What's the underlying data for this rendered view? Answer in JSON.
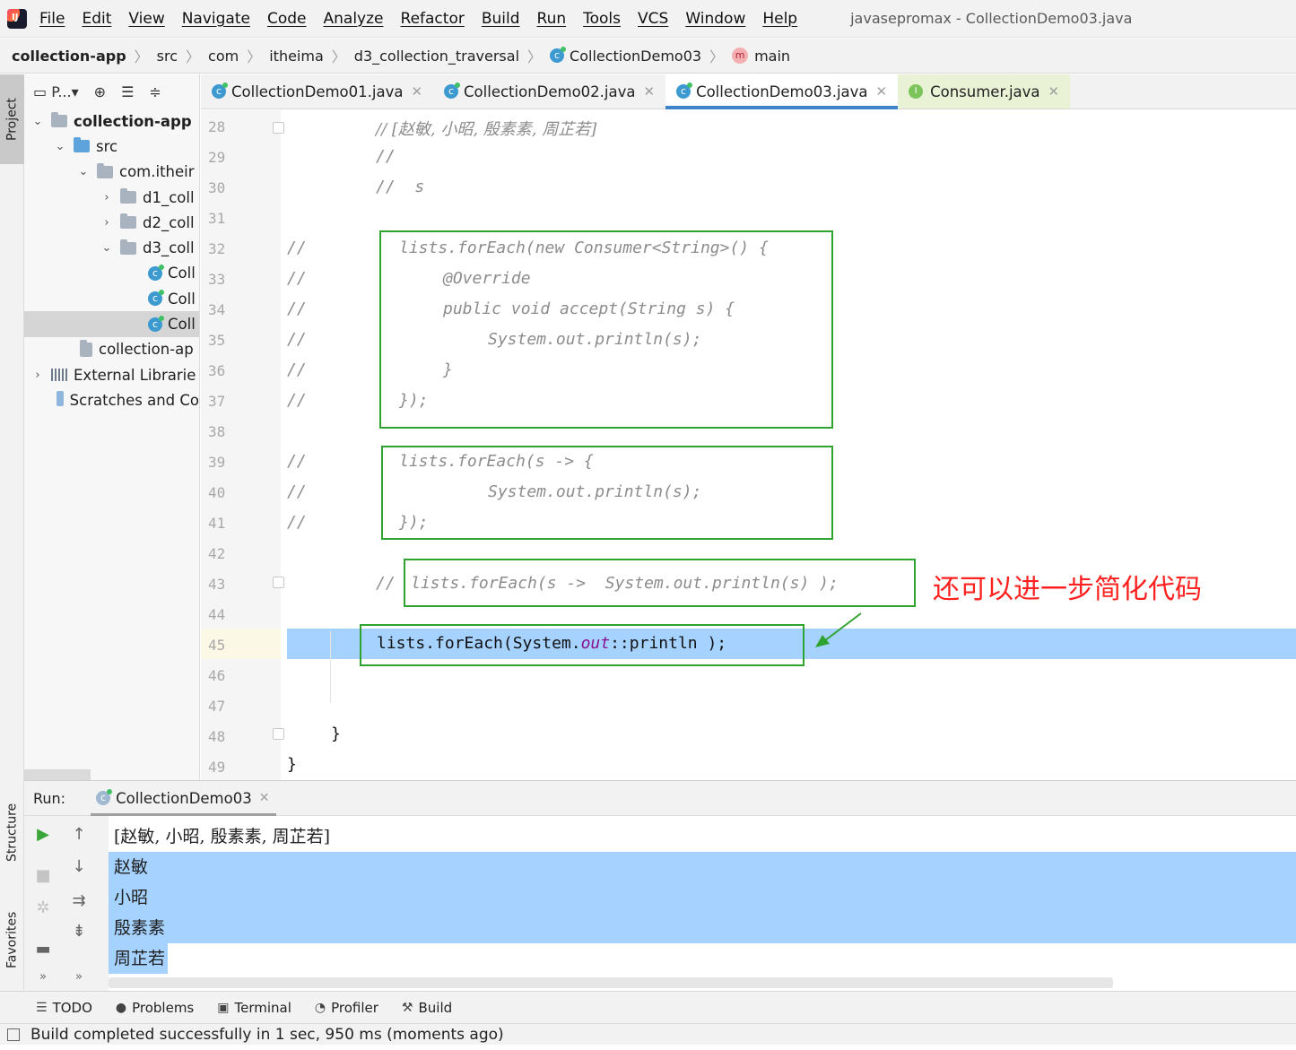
{
  "menu": {
    "items": [
      "File",
      "Edit",
      "View",
      "Navigate",
      "Code",
      "Analyze",
      "Refactor",
      "Build",
      "Run",
      "Tools",
      "VCS",
      "Window",
      "Help"
    ],
    "window_title": "javasepromax - CollectionDemo03.java"
  },
  "breadcrumb": {
    "project": "collection-app",
    "parts": [
      "src",
      "com",
      "itheima",
      "d3_collection_traversal"
    ],
    "class": "CollectionDemo03",
    "method": "main"
  },
  "left_stripe": {
    "project": "Project",
    "structure": "Structure",
    "favorites": "Favorites"
  },
  "project_panel": {
    "toolbar_label": "P...",
    "tree": [
      {
        "label": "collection-app",
        "bold": true
      },
      {
        "label": "src"
      },
      {
        "label": "com.itheir"
      },
      {
        "label": "d1_coll"
      },
      {
        "label": "d2_coll"
      },
      {
        "label": "d3_coll"
      },
      {
        "label": "Coll"
      },
      {
        "label": "Coll"
      },
      {
        "label": "Coll",
        "selected": true
      },
      {
        "label": "collection-ap"
      },
      {
        "label": "External Librarie"
      },
      {
        "label": "Scratches and Co"
      }
    ]
  },
  "tabs": [
    {
      "label": "CollectionDemo01.java"
    },
    {
      "label": "CollectionDemo02.java"
    },
    {
      "label": "CollectionDemo03.java",
      "active": true
    },
    {
      "label": "Consumer.java"
    }
  ],
  "editor": {
    "line_numbers": [
      "28",
      "29",
      "30",
      "31",
      "32",
      "33",
      "34",
      "35",
      "36",
      "37",
      "38",
      "39",
      "40",
      "41",
      "42",
      "43",
      "44",
      "45",
      "46",
      "47",
      "48",
      "49"
    ],
    "lines": {
      "l28": "// [赵敏, 小昭, 殷素素, 周芷若]",
      "l29": "//",
      "l30": "//  s",
      "l32a": "//",
      "l32b": "lists.forEach(new Consumer<String>() {",
      "l33a": "//",
      "l33b": "@Override",
      "l34a": "//",
      "l34b": "public void accept(String s) {",
      "l35a": "//",
      "l35b": "System.out.println(s);",
      "l36a": "//",
      "l36b": "}",
      "l37a": "//",
      "l37b": "});",
      "l39a": "//",
      "l39b": "lists.forEach(s -> {",
      "l40a": "//",
      "l40b": "System.out.println(s);",
      "l41a": "//",
      "l41b": "});",
      "l43a": "//",
      "l43b": "lists.forEach(s ->  System.out.println(s) );",
      "l45_pre": "lists.forEach(System.",
      "l45_out": "out",
      "l45_post": "::println );",
      "l48": "}",
      "l49": "}"
    },
    "annotation": "还可以进一步简化代码"
  },
  "run": {
    "label": "Run:",
    "tab": "CollectionDemo03",
    "output": [
      "[赵敏, 小昭, 殷素素, 周芷若]",
      "赵敏",
      "小昭",
      "殷素素",
      "周芷若"
    ]
  },
  "bottom_tools": [
    {
      "label": "TODO",
      "icon": "list-icon"
    },
    {
      "label": "Problems",
      "icon": "info-icon"
    },
    {
      "label": "Terminal",
      "icon": "terminal-icon"
    },
    {
      "label": "Profiler",
      "icon": "profiler-icon"
    },
    {
      "label": "Build",
      "icon": "hammer-icon"
    }
  ],
  "status": "Build completed successfully in 1 sec, 950 ms (moments ago)",
  "colors": {
    "selection": "#a6d2ff",
    "box_border": "#2fa32f",
    "annotation": "#ff2020",
    "active_tab": "#4083c9"
  }
}
